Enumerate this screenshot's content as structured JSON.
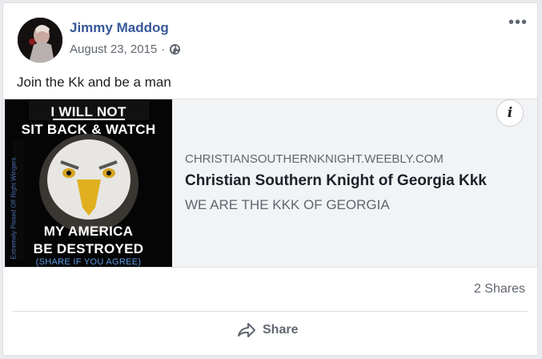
{
  "post": {
    "author": "Jimmy Maddog",
    "date": "August 23, 2015",
    "date_separator": "·",
    "privacy_icon": "globe-icon",
    "text": "Join the Kk and be a man",
    "more_label": "•••"
  },
  "link": {
    "thumbnail": {
      "line1": "I WILL NOT",
      "line2": "SIT BACK & WATCH",
      "line3": "MY AMERICA",
      "line4": "BE DESTROYED",
      "line5": "(SHARE IF YOU AGREE)",
      "side_text": "Extremely Pissed Off Right Wingers"
    },
    "info_label": "i",
    "domain": "CHRISTIANSOUTHERNKNIGHT.WEEBLY.COM",
    "title": "Christian Southern Knight of Georgia Kkk",
    "description": "WE ARE THE KKK OF GEORGIA"
  },
  "stats": {
    "shares": "2 Shares"
  },
  "actions": {
    "share_label": "Share"
  }
}
